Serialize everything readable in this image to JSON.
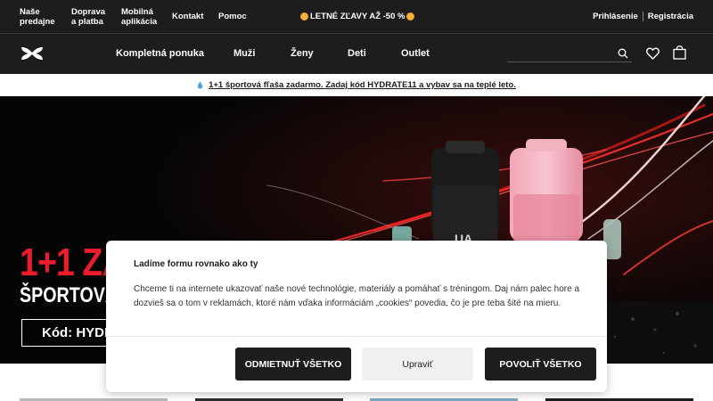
{
  "topbar": {
    "links": [
      "Naše\npredajne",
      "Doprava\na platba",
      "Mobilná\naplikácia",
      "Kontakt",
      "Pomoc"
    ],
    "promo": "LETNÉ ZĽAVY AŽ -50 %",
    "login": "Prihlásenie",
    "register": "Registrácia"
  },
  "nav": {
    "items": [
      "Kompletná ponuka",
      "Muži",
      "Ženy",
      "Deti",
      "Outlet"
    ],
    "search_placeholder": ""
  },
  "announcement": "1+1 športová fľaša zadarmo. Zadaj kód HYDRATE11 a vybav sa na teplé leto.",
  "hero": {
    "title": "1+1 ZA",
    "subtitle": "ŠPORTOVÁ FL",
    "code": "Kód: HYDRAT",
    "colors": {
      "title_red": "#ec1c2d"
    }
  },
  "cookie": {
    "title": "Ladíme formu rovnako ako ty",
    "body": "Chceme ti na internete ukazovať naše nové technológie, materiály a pomáhať s tréningom. Daj nám palec hore a dozvieš sa o tom v reklamách, ktoré nám vďaka informáciám „cookies“ povedia, čo je pre teba šité na mieru.",
    "reject": "ODMIETNUŤ VŠETKO",
    "customize": "Upraviť",
    "accept": "POVOLIŤ VŠETKO"
  },
  "icons": [
    "under-armour-logo",
    "search-icon",
    "heart-icon",
    "shopping-bag-icon",
    "sun-icon",
    "water-drop-icon"
  ]
}
